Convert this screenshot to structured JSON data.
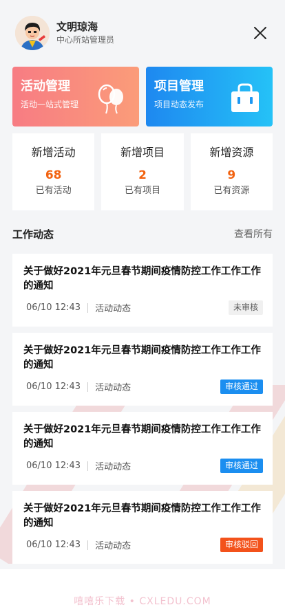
{
  "user": {
    "name": "文明琼海",
    "role": "中心所站管理员"
  },
  "banners": [
    {
      "title": "活动管理",
      "subtitle": "活动一站式管理",
      "icon": "balloons-icon"
    },
    {
      "title": "项目管理",
      "subtitle": "项目动态发布",
      "icon": "shopping-bag-icon"
    }
  ],
  "stats": [
    {
      "title": "新增活动",
      "value": "68",
      "label": "已有活动"
    },
    {
      "title": "新增项目",
      "value": "2",
      "label": "已有项目"
    },
    {
      "title": "新增资源",
      "value": "9",
      "label": "已有资源"
    }
  ],
  "section": {
    "title": "工作动态",
    "more": "查看所有"
  },
  "feed": [
    {
      "title": "关于做好2021年元旦春节期间疫情防控工作工作工作的通知",
      "date": "06/10 12:43",
      "category": "活动动态",
      "status": "未审核",
      "status_type": "pending"
    },
    {
      "title": "关于做好2021年元旦春节期间疫情防控工作工作工作的通知",
      "date": "06/10 12:43",
      "category": "活动动态",
      "status": "审核通过",
      "status_type": "approved"
    },
    {
      "title": "关于做好2021年元旦春节期间疫情防控工作工作工作的通知",
      "date": "06/10 12:43",
      "category": "活动动态",
      "status": "审核通过",
      "status_type": "approved"
    },
    {
      "title": "关于做好2021年元旦春节期间疫情防控工作工作工作的通知",
      "date": "06/10 12:43",
      "category": "活动动态",
      "status": "审核驳回",
      "status_type": "rejected"
    }
  ],
  "watermark": "嘻嘻乐下载 • CXLEDU.COM",
  "colors": {
    "accent_orange": "#f2620f",
    "approved": "#1b8ef0",
    "rejected": "#f3521b"
  }
}
